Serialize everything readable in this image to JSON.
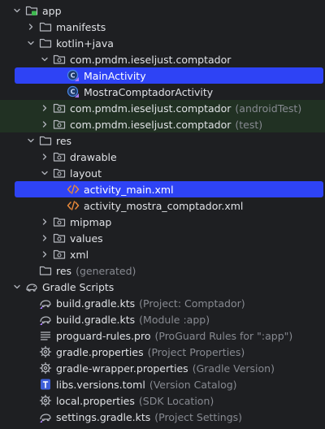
{
  "tree": {
    "app": {
      "label": "app"
    },
    "manifests": {
      "label": "manifests"
    },
    "kotlin_java": {
      "label": "kotlin+java"
    },
    "pkg_main": {
      "label": "com.pmdm.ieseljust.comptador"
    },
    "main_activity": {
      "label": "MainActivity"
    },
    "mostra_activity": {
      "label": "MostraComptadorActivity"
    },
    "pkg_android_test": {
      "label": "com.pmdm.ieseljust.comptador",
      "hint": "(androidTest)"
    },
    "pkg_test": {
      "label": "com.pmdm.ieseljust.comptador",
      "hint": "(test)"
    },
    "res": {
      "label": "res"
    },
    "drawable": {
      "label": "drawable"
    },
    "layout": {
      "label": "layout"
    },
    "activity_main": {
      "label": "activity_main.xml"
    },
    "activity_mostra": {
      "label": "activity_mostra_comptador.xml"
    },
    "mipmap": {
      "label": "mipmap"
    },
    "values": {
      "label": "values"
    },
    "xml": {
      "label": "xml"
    },
    "res_generated": {
      "label": "res",
      "hint": "(generated)"
    },
    "gradle_scripts": {
      "label": "Gradle Scripts"
    },
    "build_project": {
      "label": "build.gradle.kts",
      "hint": "(Project: Comptador)"
    },
    "build_module": {
      "label": "build.gradle.kts",
      "hint": "(Module :app)"
    },
    "proguard": {
      "label": "proguard-rules.pro",
      "hint": "(ProGuard Rules for \":app\")"
    },
    "gradle_properties": {
      "label": "gradle.properties",
      "hint": "(Project Properties)"
    },
    "gradle_wrapper": {
      "label": "gradle-wrapper.properties",
      "hint": "(Gradle Version)"
    },
    "libs_versions": {
      "label": "libs.versions.toml",
      "hint": "(Version Catalog)"
    },
    "local_properties": {
      "label": "local.properties",
      "hint": "(SDK Location)"
    },
    "settings_gradle": {
      "label": "settings.gradle.kts",
      "hint": "(Project Settings)"
    }
  },
  "colors": {
    "background": "#1e1f22",
    "selection": "#2e43f5",
    "test_tint": "#213123",
    "hint_text": "#878a91",
    "kotlin_class": "#4a89e8",
    "xml_icon": "#e8893a"
  }
}
